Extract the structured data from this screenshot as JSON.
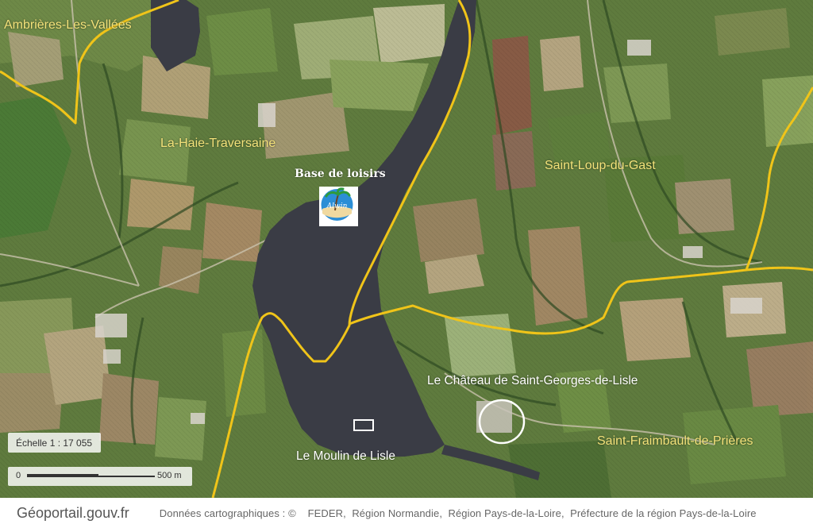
{
  "map": {
    "communes": [
      {
        "name": "Ambrières-Les-Vallées"
      },
      {
        "name": "La-Haie-Traversaine"
      },
      {
        "name": "Saint-Loup-du-Gast"
      },
      {
        "name": "Saint-Fraimbault-de-Prières"
      }
    ],
    "places": [
      {
        "name": "Le Château de Saint-Georges-de-Lisle"
      },
      {
        "name": "Le Moulin de Lisle"
      }
    ],
    "poi": {
      "title": "Base de loisirs",
      "icon": "leisure-base-logo-icon",
      "logo_text": "Alwin"
    },
    "colors": {
      "boundary": "#f0c419",
      "water": "#3a3c45",
      "commune_label": "#f3e27a"
    }
  },
  "scale": {
    "text": "Échelle 1 : 17 055",
    "bar_start": "0",
    "bar_end": "500 m"
  },
  "footer": {
    "brand": "Géoportail.gouv.fr",
    "attribution_prefix": "Données cartographiques : ©",
    "sources": [
      "FEDER",
      "Région Normandie",
      "Région Pays-de-la-Loire",
      "Préfecture de la région Pays-de-la-Loire"
    ]
  }
}
